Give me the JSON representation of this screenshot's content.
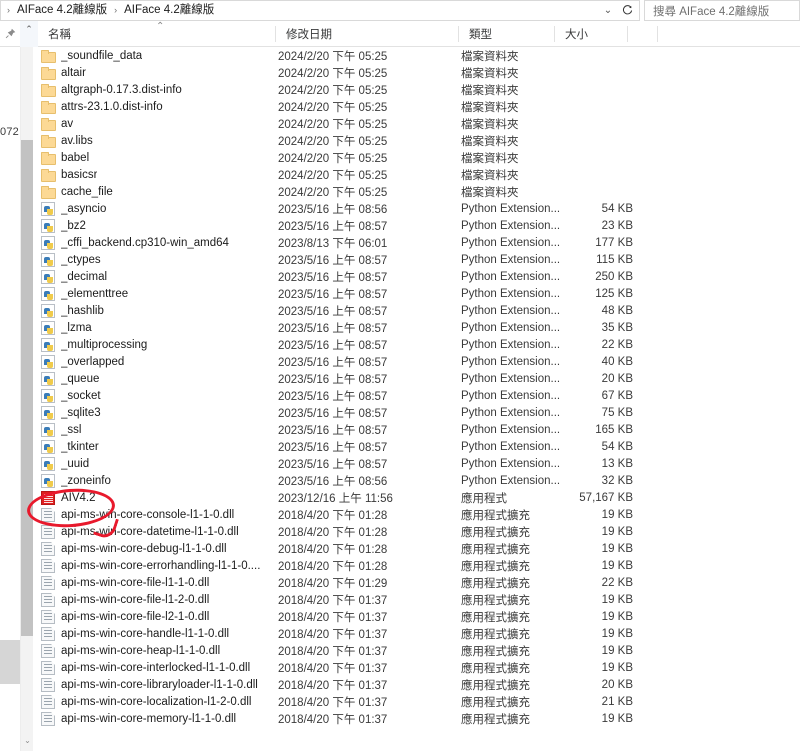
{
  "addressbar": {
    "crumb_root": "AIFace 4.2離線版",
    "crumb_current": "AIFace 4.2離線版",
    "separator": "›",
    "dropdown_icon": "chevron-down-icon",
    "refresh_icon": "refresh-icon",
    "search_placeholder": "搜尋 AIFace 4.2離線版"
  },
  "columns": {
    "name": "名稱",
    "date_modified": "修改日期",
    "type": "類型",
    "size": "大小",
    "sort_caret": "⌃",
    "pin_icon": "pin-icon",
    "updown_icon": "⌃"
  },
  "gutter": {
    "fragment_text": "072",
    "scroll_down_icon": "⌄"
  },
  "types": {
    "folder": "檔案資料夾",
    "python_extension": "Python Extension...",
    "application": "應用程式",
    "application_extension": "應用程式擴充"
  },
  "annotation": {
    "color": "#e8192c",
    "shape": "ellipse-highlight",
    "target": "AIV4.2"
  },
  "rows": [
    {
      "icon": "folder",
      "name": "_soundfile_data",
      "date": "2024/2/20 下午 05:25",
      "type": "檔案資料夾",
      "size": ""
    },
    {
      "icon": "folder",
      "name": "altair",
      "date": "2024/2/20 下午 05:25",
      "type": "檔案資料夾",
      "size": ""
    },
    {
      "icon": "folder",
      "name": "altgraph-0.17.3.dist-info",
      "date": "2024/2/20 下午 05:25",
      "type": "檔案資料夾",
      "size": ""
    },
    {
      "icon": "folder",
      "name": "attrs-23.1.0.dist-info",
      "date": "2024/2/20 下午 05:25",
      "type": "檔案資料夾",
      "size": ""
    },
    {
      "icon": "folder",
      "name": "av",
      "date": "2024/2/20 下午 05:25",
      "type": "檔案資料夾",
      "size": ""
    },
    {
      "icon": "folder",
      "name": "av.libs",
      "date": "2024/2/20 下午 05:25",
      "type": "檔案資料夾",
      "size": ""
    },
    {
      "icon": "folder",
      "name": "babel",
      "date": "2024/2/20 下午 05:25",
      "type": "檔案資料夾",
      "size": ""
    },
    {
      "icon": "folder",
      "name": "basicsr",
      "date": "2024/2/20 下午 05:25",
      "type": "檔案資料夾",
      "size": ""
    },
    {
      "icon": "folder",
      "name": "cache_file",
      "date": "2024/2/20 下午 05:25",
      "type": "檔案資料夾",
      "size": ""
    },
    {
      "icon": "py",
      "name": "_asyncio",
      "date": "2023/5/16 上午 08:56",
      "type": "Python Extension...",
      "size": "54 KB"
    },
    {
      "icon": "py",
      "name": "_bz2",
      "date": "2023/5/16 上午 08:57",
      "type": "Python Extension...",
      "size": "23 KB"
    },
    {
      "icon": "py",
      "name": "_cffi_backend.cp310-win_amd64",
      "date": "2023/8/13 下午 06:01",
      "type": "Python Extension...",
      "size": "177 KB"
    },
    {
      "icon": "py",
      "name": "_ctypes",
      "date": "2023/5/16 上午 08:57",
      "type": "Python Extension...",
      "size": "115 KB"
    },
    {
      "icon": "py",
      "name": "_decimal",
      "date": "2023/5/16 上午 08:57",
      "type": "Python Extension...",
      "size": "250 KB"
    },
    {
      "icon": "py",
      "name": "_elementtree",
      "date": "2023/5/16 上午 08:57",
      "type": "Python Extension...",
      "size": "125 KB"
    },
    {
      "icon": "py",
      "name": "_hashlib",
      "date": "2023/5/16 上午 08:57",
      "type": "Python Extension...",
      "size": "48 KB"
    },
    {
      "icon": "py",
      "name": "_lzma",
      "date": "2023/5/16 上午 08:57",
      "type": "Python Extension...",
      "size": "35 KB"
    },
    {
      "icon": "py",
      "name": "_multiprocessing",
      "date": "2023/5/16 上午 08:57",
      "type": "Python Extension...",
      "size": "22 KB"
    },
    {
      "icon": "py",
      "name": "_overlapped",
      "date": "2023/5/16 上午 08:57",
      "type": "Python Extension...",
      "size": "40 KB"
    },
    {
      "icon": "py",
      "name": "_queue",
      "date": "2023/5/16 上午 08:57",
      "type": "Python Extension...",
      "size": "20 KB"
    },
    {
      "icon": "py",
      "name": "_socket",
      "date": "2023/5/16 上午 08:57",
      "type": "Python Extension...",
      "size": "67 KB"
    },
    {
      "icon": "py",
      "name": "_sqlite3",
      "date": "2023/5/16 上午 08:57",
      "type": "Python Extension...",
      "size": "75 KB"
    },
    {
      "icon": "py",
      "name": "_ssl",
      "date": "2023/5/16 上午 08:57",
      "type": "Python Extension...",
      "size": "165 KB"
    },
    {
      "icon": "py",
      "name": "_tkinter",
      "date": "2023/5/16 上午 08:57",
      "type": "Python Extension...",
      "size": "54 KB"
    },
    {
      "icon": "py",
      "name": "_uuid",
      "date": "2023/5/16 上午 08:57",
      "type": "Python Extension...",
      "size": "13 KB"
    },
    {
      "icon": "py",
      "name": "_zoneinfo",
      "date": "2023/5/16 上午 08:56",
      "type": "Python Extension...",
      "size": "32 KB"
    },
    {
      "icon": "app",
      "name": "AIV4.2",
      "date": "2023/12/16 上午 11:56",
      "type": "應用程式",
      "size": "57,167 KB"
    },
    {
      "icon": "dll",
      "name": "api-ms-win-core-console-l1-1-0.dll",
      "date": "2018/4/20 下午 01:28",
      "type": "應用程式擴充",
      "size": "19 KB"
    },
    {
      "icon": "dll",
      "name": "api-ms-win-core-datetime-l1-1-0.dll",
      "date": "2018/4/20 下午 01:28",
      "type": "應用程式擴充",
      "size": "19 KB"
    },
    {
      "icon": "dll",
      "name": "api-ms-win-core-debug-l1-1-0.dll",
      "date": "2018/4/20 下午 01:28",
      "type": "應用程式擴充",
      "size": "19 KB"
    },
    {
      "icon": "dll",
      "name": "api-ms-win-core-errorhandling-l1-1-0....",
      "date": "2018/4/20 下午 01:28",
      "type": "應用程式擴充",
      "size": "19 KB"
    },
    {
      "icon": "dll",
      "name": "api-ms-win-core-file-l1-1-0.dll",
      "date": "2018/4/20 下午 01:29",
      "type": "應用程式擴充",
      "size": "22 KB"
    },
    {
      "icon": "dll",
      "name": "api-ms-win-core-file-l1-2-0.dll",
      "date": "2018/4/20 下午 01:37",
      "type": "應用程式擴充",
      "size": "19 KB"
    },
    {
      "icon": "dll",
      "name": "api-ms-win-core-file-l2-1-0.dll",
      "date": "2018/4/20 下午 01:37",
      "type": "應用程式擴充",
      "size": "19 KB"
    },
    {
      "icon": "dll",
      "name": "api-ms-win-core-handle-l1-1-0.dll",
      "date": "2018/4/20 下午 01:37",
      "type": "應用程式擴充",
      "size": "19 KB"
    },
    {
      "icon": "dll",
      "name": "api-ms-win-core-heap-l1-1-0.dll",
      "date": "2018/4/20 下午 01:37",
      "type": "應用程式擴充",
      "size": "19 KB"
    },
    {
      "icon": "dll",
      "name": "api-ms-win-core-interlocked-l1-1-0.dll",
      "date": "2018/4/20 下午 01:37",
      "type": "應用程式擴充",
      "size": "19 KB"
    },
    {
      "icon": "dll",
      "name": "api-ms-win-core-libraryloader-l1-1-0.dll",
      "date": "2018/4/20 下午 01:37",
      "type": "應用程式擴充",
      "size": "20 KB"
    },
    {
      "icon": "dll",
      "name": "api-ms-win-core-localization-l1-2-0.dll",
      "date": "2018/4/20 下午 01:37",
      "type": "應用程式擴充",
      "size": "21 KB"
    },
    {
      "icon": "dll",
      "name": "api-ms-win-core-memory-l1-1-0.dll",
      "date": "2018/4/20 下午 01:37",
      "type": "應用程式擴充",
      "size": "19 KB"
    }
  ]
}
